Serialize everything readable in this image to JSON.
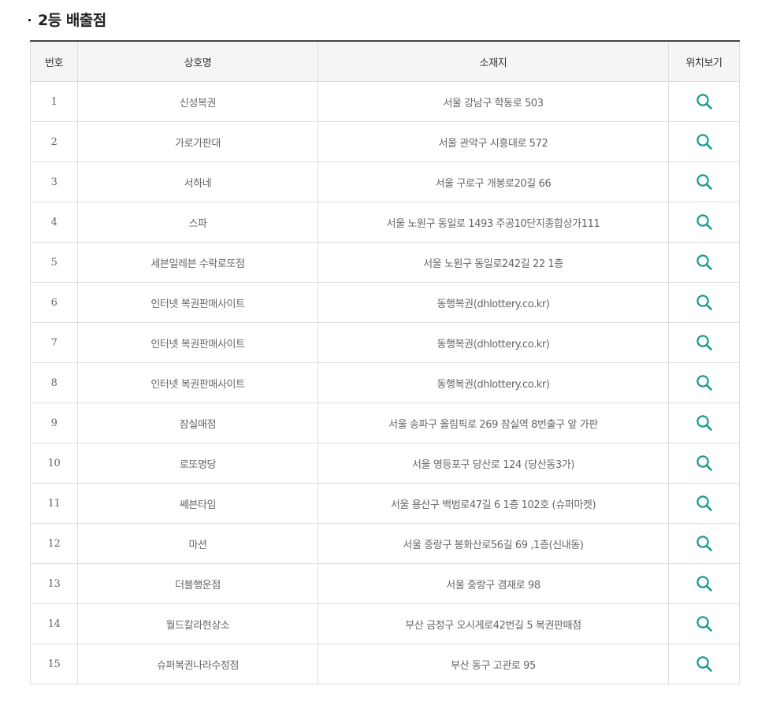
{
  "section": {
    "title": "2등 배출점"
  },
  "table": {
    "headers": {
      "no": "번호",
      "name": "상호명",
      "address": "소재지",
      "location": "위치보기"
    },
    "rows": [
      {
        "no": "1",
        "name": "신성복권",
        "address": "서울 강남구 학동로 503"
      },
      {
        "no": "2",
        "name": "가로가판대",
        "address": "서울 관악구 시흥대로 572"
      },
      {
        "no": "3",
        "name": "서하네",
        "address": "서울 구로구 개봉로20길 66"
      },
      {
        "no": "4",
        "name": "스파",
        "address": "서울 노원구 동일로 1493 주공10단지종합상가111"
      },
      {
        "no": "5",
        "name": "세븐일레븐 수락로또점",
        "address": "서울 노원구 동일로242길 22 1층"
      },
      {
        "no": "6",
        "name": "인터넷 복권판매사이트",
        "address": "동행복권(dhlottery.co.kr)"
      },
      {
        "no": "7",
        "name": "인터넷 복권판매사이트",
        "address": "동행복권(dhlottery.co.kr)"
      },
      {
        "no": "8",
        "name": "인터넷 복권판매사이트",
        "address": "동행복권(dhlottery.co.kr)"
      },
      {
        "no": "9",
        "name": "잠실매점",
        "address": "서울 송파구 올림픽로 269 잠실역 8번출구 앞 가판"
      },
      {
        "no": "10",
        "name": "로또명당",
        "address": "서울 영등포구 당산로 124 (당산동3가)"
      },
      {
        "no": "11",
        "name": "쎄븐타임",
        "address": "서울 용산구 백범로47길 6 1층 102호 (슈퍼마켓)"
      },
      {
        "no": "12",
        "name": "마션",
        "address": "서울 중랑구 봉화산로56길 69 ,1층(신내동)"
      },
      {
        "no": "13",
        "name": "더블행운점",
        "address": "서울 중랑구 겸재로 98"
      },
      {
        "no": "14",
        "name": "월드칼라현상소",
        "address": "부산 금정구 오시게로42번길 5 복권판매점"
      },
      {
        "no": "15",
        "name": "슈퍼복권나라수정점",
        "address": "부산 동구 고관로 95"
      }
    ]
  },
  "icons": {
    "location": "search-icon"
  },
  "colors": {
    "accent": "#1a9a8c",
    "header_bg": "#f5f5f5",
    "border": "#dddddd",
    "top_border": "#444444"
  }
}
